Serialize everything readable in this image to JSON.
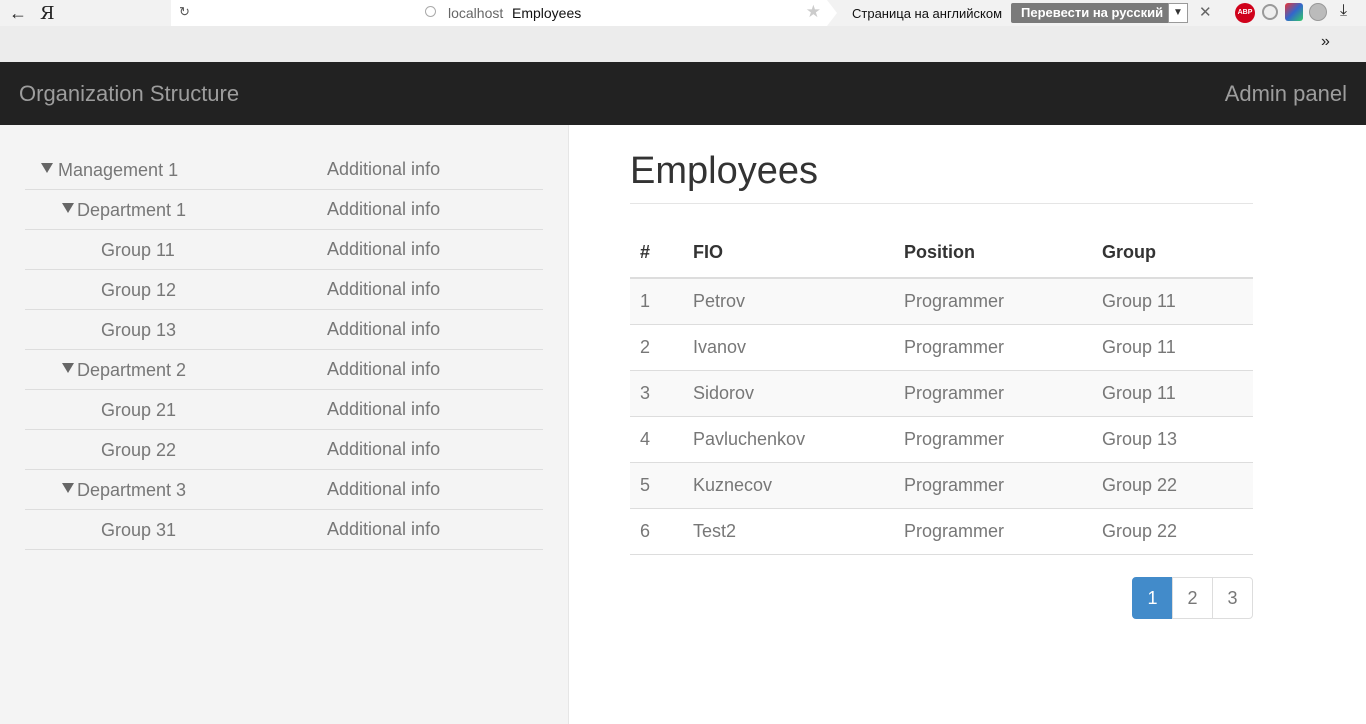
{
  "browser": {
    "address_host": "localhost",
    "address_title": "Employees",
    "translate_prompt": "Страница на английском",
    "translate_button": "Перевести на русский",
    "ya_logo": "Я",
    "abp_label": "ABP"
  },
  "navbar": {
    "brand": "Organization Structure",
    "admin_link": "Admin panel"
  },
  "tree": [
    {
      "label": "Management 1",
      "info": "Additional info",
      "level": 0,
      "expanded": true
    },
    {
      "label": "Department 1",
      "info": "Additional info",
      "level": 1,
      "expanded": true
    },
    {
      "label": "Group 11",
      "info": "Additional info",
      "level": 2
    },
    {
      "label": "Group 12",
      "info": "Additional info",
      "level": 2
    },
    {
      "label": "Group 13",
      "info": "Additional info",
      "level": 2
    },
    {
      "label": "Department 2",
      "info": "Additional info",
      "level": 1,
      "expanded": true
    },
    {
      "label": "Group 21",
      "info": "Additional info",
      "level": 2
    },
    {
      "label": "Group 22",
      "info": "Additional info",
      "level": 2
    },
    {
      "label": "Department 3",
      "info": "Additional info",
      "level": 1,
      "expanded": true
    },
    {
      "label": "Group 31",
      "info": "Additional info",
      "level": 2
    }
  ],
  "main": {
    "title": "Employees",
    "columns": [
      "#",
      "FIO",
      "Position",
      "Group"
    ],
    "rows": [
      [
        "1",
        "Petrov",
        "Programmer",
        "Group 11"
      ],
      [
        "2",
        "Ivanov",
        "Programmer",
        "Group 11"
      ],
      [
        "3",
        "Sidorov",
        "Programmer",
        "Group 11"
      ],
      [
        "4",
        "Pavluchenkov",
        "Programmer",
        "Group 13"
      ],
      [
        "5",
        "Kuznecov",
        "Programmer",
        "Group 22"
      ],
      [
        "6",
        "Test2",
        "Programmer",
        "Group 22"
      ]
    ],
    "pagination": [
      "1",
      "2",
      "3"
    ],
    "active_page": "1"
  }
}
